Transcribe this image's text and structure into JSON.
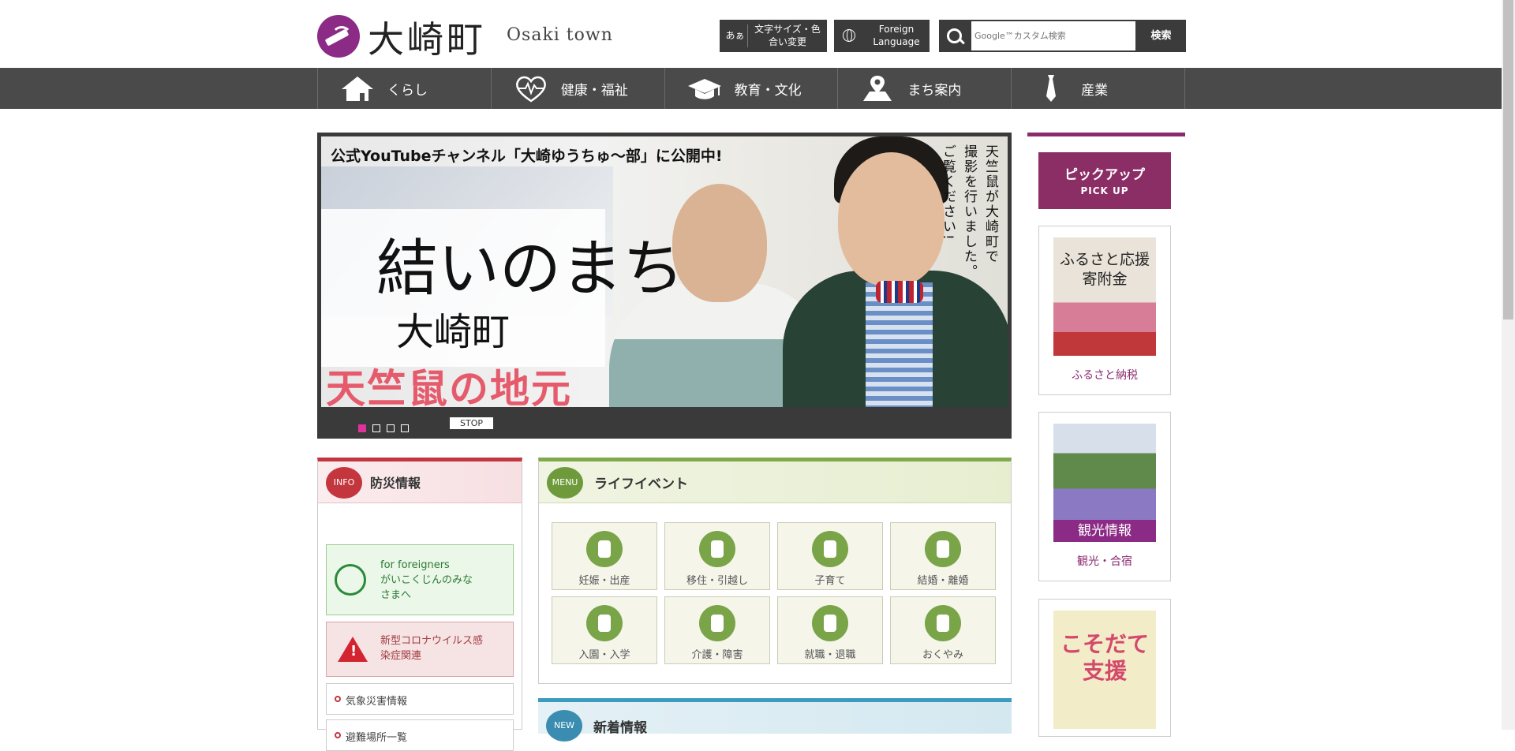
{
  "header": {
    "logo_jp": "大崎町",
    "logo_en": "Osaki town",
    "fontsize_badge": "あぁ",
    "fontsize_label": "文字サイズ・色合い変更",
    "foreign_label": "Foreign Language",
    "search_placeholder": "Google™カスタム検索",
    "search_button": "検索"
  },
  "nav": {
    "items": [
      {
        "label": "くらし",
        "icon": "house-icon"
      },
      {
        "label": "健康・福祉",
        "icon": "heart-pulse-icon"
      },
      {
        "label": "教育・文化",
        "icon": "graduation-cap-icon"
      },
      {
        "label": "まち案内",
        "icon": "map-pin-icon"
      },
      {
        "label": "産業",
        "icon": "necktie-icon"
      }
    ]
  },
  "banner": {
    "title": "公式YouTubeチャンネル「大崎ゆうちゅ～部」に公開中!",
    "logo_main": "結いのまち",
    "logo_sub": "大崎町",
    "pink_text": "天竺鼠の地元",
    "vertical_1": "天竺鼠が大崎町で",
    "vertical_2": "撮影を行いました。",
    "vertical_3": "ご覧ください!",
    "stop_label": "STOP",
    "active_slide": 1,
    "slide_count": 4
  },
  "right": {
    "pickup_jp": "ピックアップ",
    "pickup_en": "PICK UP",
    "card1_img": "ふるさと応援寄附金",
    "card1_caption": "ふるさと納税",
    "card2_band": "観光情報",
    "card2_caption": "観光・合宿",
    "card3_img": "こそだて支援"
  },
  "info": {
    "badge": "INFO",
    "title": "防災情報",
    "foreigners_en": "for foreigners",
    "foreigners_jp": "がいこくじんのみなさまへ",
    "corona": "新型コロナウイルス感染症関連",
    "link1": "気象災害情報",
    "link2": "避難場所一覧"
  },
  "life": {
    "badge": "MENU",
    "title": "ライフイベント",
    "items": [
      "妊娠・出産",
      "移住・引越し",
      "子育て",
      "結婚・離婚",
      "入園・入学",
      "介護・障害",
      "就職・退職",
      "おくやみ"
    ]
  },
  "news": {
    "badge": "NEW",
    "title": "新着情報"
  }
}
